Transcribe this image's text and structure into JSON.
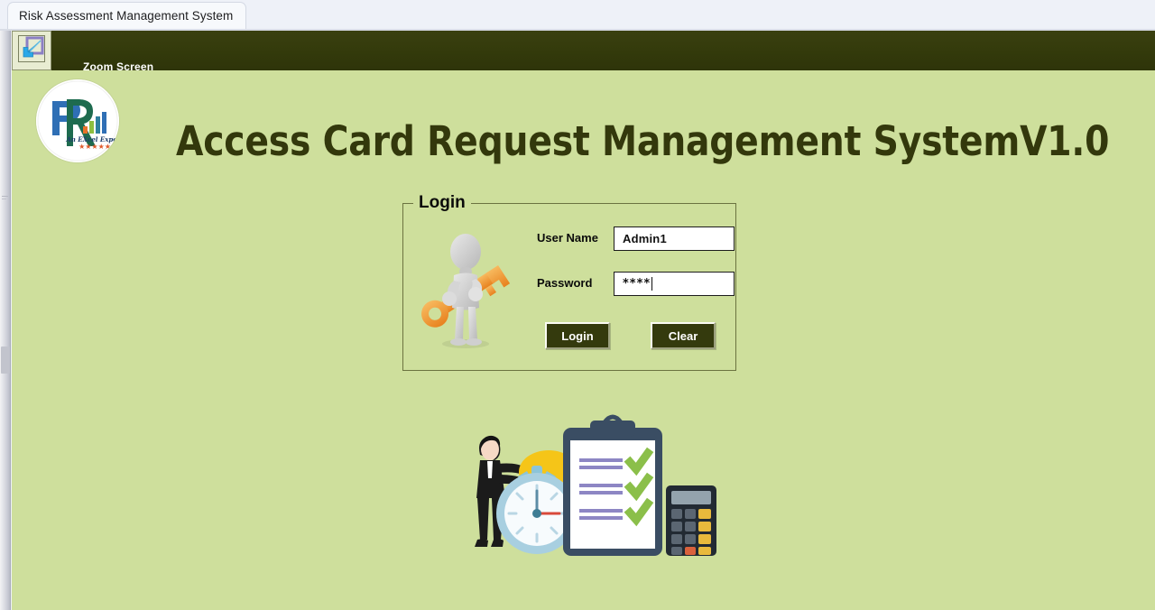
{
  "window": {
    "tab_title": "Risk Assessment Management System"
  },
  "toolbar": {
    "icon_name": "shrink-screen-icon",
    "zoom_label": "Zoom Screen",
    "minus_label": "-",
    "plus_label": "+",
    "left_arrow": "◄",
    "right_arrow": "►"
  },
  "branding": {
    "logo_letters": "PR",
    "logo_tagline": "An EXcel Expert",
    "logo_stars": "★★★★★"
  },
  "header": {
    "title": "Access Card Request Management SystemV1.0"
  },
  "login": {
    "legend": "Login",
    "username_label": "User Name",
    "username_value": "Admin1",
    "username_placeholder": "",
    "password_label": "Password",
    "password_value": "****",
    "password_placeholder": "",
    "login_button": "Login",
    "clear_button": "Clear"
  },
  "colors": {
    "toolbar_dark": "#333a0b",
    "canvas_green": "#cedf9c",
    "title_olive": "#33380c",
    "button_olive": "#343a0d",
    "accent_orange": "#ef9c34",
    "check_green": "#8bbf4a"
  }
}
